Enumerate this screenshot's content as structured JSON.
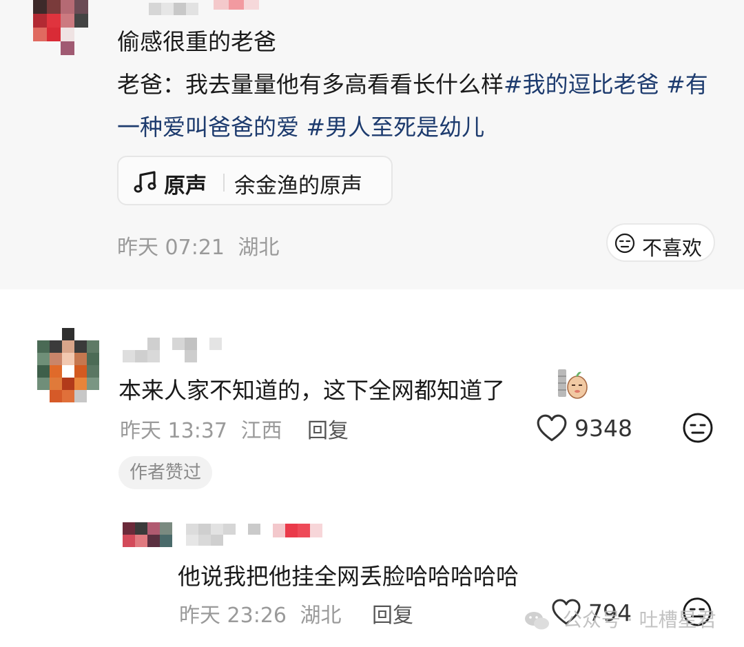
{
  "post": {
    "title": "偷感很重的老爸",
    "body_text": "老爸：我去量量他有多高看看长什么样",
    "tags": [
      "#我的逗比老爸",
      "#有一种爱叫爸爸的爱",
      "#男人至死是幼儿"
    ],
    "music": {
      "label": "原声",
      "source": "余金渔的原声"
    },
    "time": "昨天 07:21",
    "location": "湖北",
    "dislike_label": "不喜欢"
  },
  "comments": [
    {
      "text": "本来人家不知道的，这下全网都知道了",
      "time": "昨天 13:37",
      "location": "江西",
      "reply_label": "回复",
      "likes": "9348",
      "badge": "作者赞过"
    },
    {
      "text": "他说我把他挂全网丢脸哈哈哈哈哈",
      "time": "昨天 23:26",
      "location": "湖北",
      "reply_label": "回复",
      "likes": "794"
    }
  ],
  "watermark": "公众号 · 吐槽星君",
  "icons": {
    "music": "music-note-icon",
    "dislike": "neutral-face-icon",
    "like": "heart-outline-icon",
    "comment_dislike": "neutral-face-icon",
    "sticker": "sticker-emoji-icon",
    "watermark": "wechat-icon"
  },
  "colors": {
    "tag": "#1d3b6e",
    "meta": "#9a9a9a",
    "post_bg": "#f7f7f7"
  }
}
